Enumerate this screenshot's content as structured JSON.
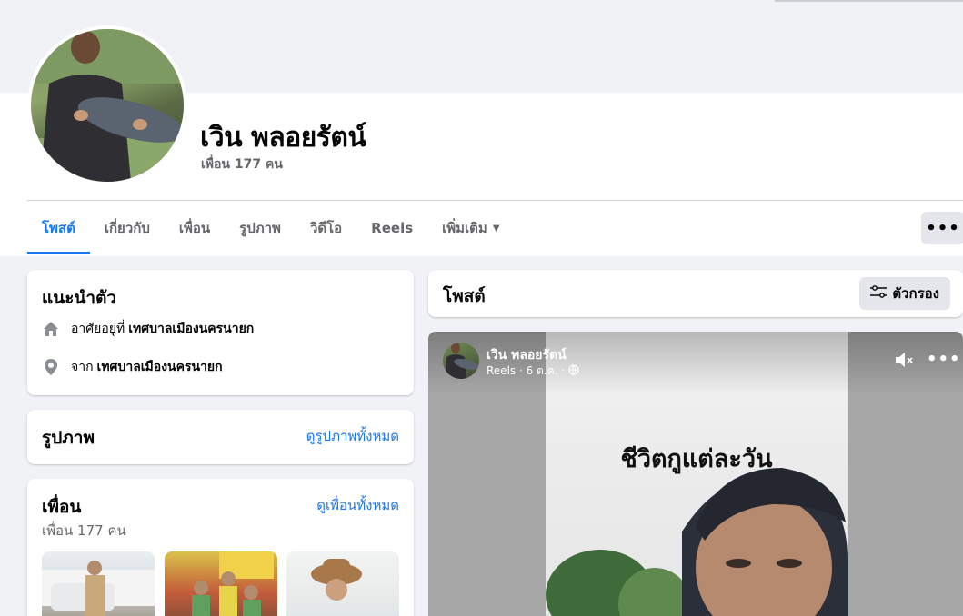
{
  "profile": {
    "name": "เวิน พลอยรัตน์",
    "friend_count": "เพื่อน 177 คน"
  },
  "tabs": [
    {
      "label": "โพสต์",
      "active": true
    },
    {
      "label": "เกี่ยวกับ",
      "active": false
    },
    {
      "label": "เพื่อน",
      "active": false
    },
    {
      "label": "รูปภาพ",
      "active": false
    },
    {
      "label": "วิดีโอ",
      "active": false
    },
    {
      "label": "Reels",
      "active": false
    },
    {
      "label": "เพิ่มเติม",
      "active": false
    }
  ],
  "more_button": "•••",
  "intro": {
    "title": "แนะนำตัว",
    "lives_prefix": "อาศัยอยู่ที่",
    "lives_value": "เทศบาลเมืองนครนายก",
    "from_prefix": "จาก",
    "from_value": "เทศบาลเมืองนครนายก",
    "icons": [
      "home-icon",
      "location-pin-icon"
    ]
  },
  "photos": {
    "title": "รูปภาพ",
    "see_all": "ดูรูปภาพทั้งหมด"
  },
  "friends": {
    "title": "เพื่อน",
    "see_all": "ดูเพื่อนทั้งหมด",
    "count": "เพื่อน 177 คน"
  },
  "posts": {
    "title": "โพสต์",
    "filter_label": "ตัวกรอง"
  },
  "reel": {
    "author": "เวิน พลอยรัตน์",
    "meta": "Reels · 6 ต.ค. ·",
    "caption": "ชีวิตกูแต่ละวัน",
    "more": "•••"
  },
  "colors": {
    "accent": "#1877f2",
    "background": "#f0f2f5",
    "secondary_text": "#65676b",
    "button_gray": "#e4e6eb"
  }
}
